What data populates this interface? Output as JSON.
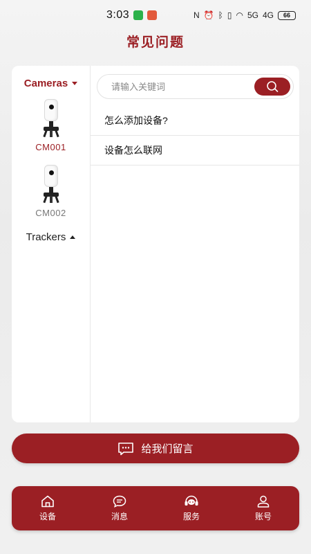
{
  "status_bar": {
    "time": "3:03",
    "battery": "66",
    "network_5g": "5G",
    "network_4g": "4G"
  },
  "page": {
    "title": "常见问题"
  },
  "sidebar": {
    "categories": [
      {
        "label": "Cameras",
        "expanded": true,
        "devices": [
          {
            "label": "CM001",
            "selected": true
          },
          {
            "label": "CM002",
            "selected": false
          }
        ]
      },
      {
        "label": "Trackers",
        "expanded": false
      }
    ]
  },
  "search": {
    "placeholder": "请输入关键词",
    "value": ""
  },
  "faq": {
    "items": [
      {
        "question": "怎么添加设备?"
      },
      {
        "question": "设备怎么联网"
      }
    ]
  },
  "message_button": {
    "label": "给我们留言"
  },
  "bottom_nav": {
    "items": [
      {
        "label": "设备",
        "icon": "home-icon"
      },
      {
        "label": "消息",
        "icon": "chat-icon"
      },
      {
        "label": "服务",
        "icon": "headset-icon"
      },
      {
        "label": "账号",
        "icon": "user-icon"
      }
    ]
  },
  "colors": {
    "accent": "#9b1f24",
    "background": "#efefef",
    "card": "#ffffff"
  }
}
